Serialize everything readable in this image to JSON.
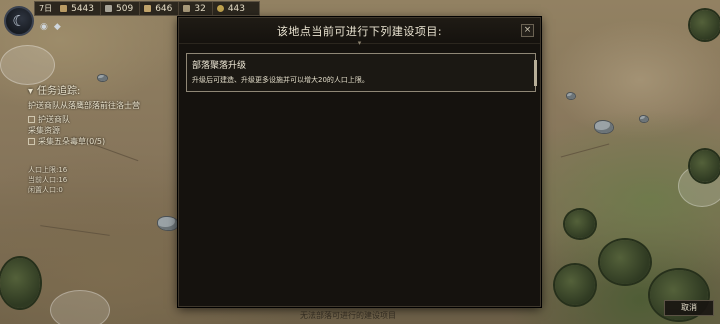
{
  "hud": {
    "day_label": "7日",
    "resources": [
      {
        "name": "wood-icon",
        "value": "5443",
        "color": "#b89a63"
      },
      {
        "name": "stone-icon",
        "value": "509",
        "color": "#a7a397"
      },
      {
        "name": "food-icon",
        "value": "646",
        "color": "#c0a36a"
      },
      {
        "name": "population-icon",
        "value": "32",
        "color": "#a89a7a"
      },
      {
        "name": "coin-icon",
        "value": "443",
        "color": "#bfa24e"
      }
    ]
  },
  "quest": {
    "title": "任务追踪:",
    "desc": "护送商队从落鹰部落前往洛士营",
    "items": [
      "护送商队",
      "采集资源",
      "采集五朵毒草(0/5)"
    ],
    "stats": [
      "人口上限:16",
      "当前人口:16",
      "闲置人口:0"
    ]
  },
  "modal": {
    "title": "该地点当前可进行下列建设项目:",
    "close_label": "×",
    "project": {
      "name": "部落聚落升级",
      "desc": "升级后可建造、升级更多设施并可以增大20的人口上限。"
    }
  },
  "footer": {
    "hint": "无法部落可进行的建设项目",
    "cancel_label": "取消"
  }
}
